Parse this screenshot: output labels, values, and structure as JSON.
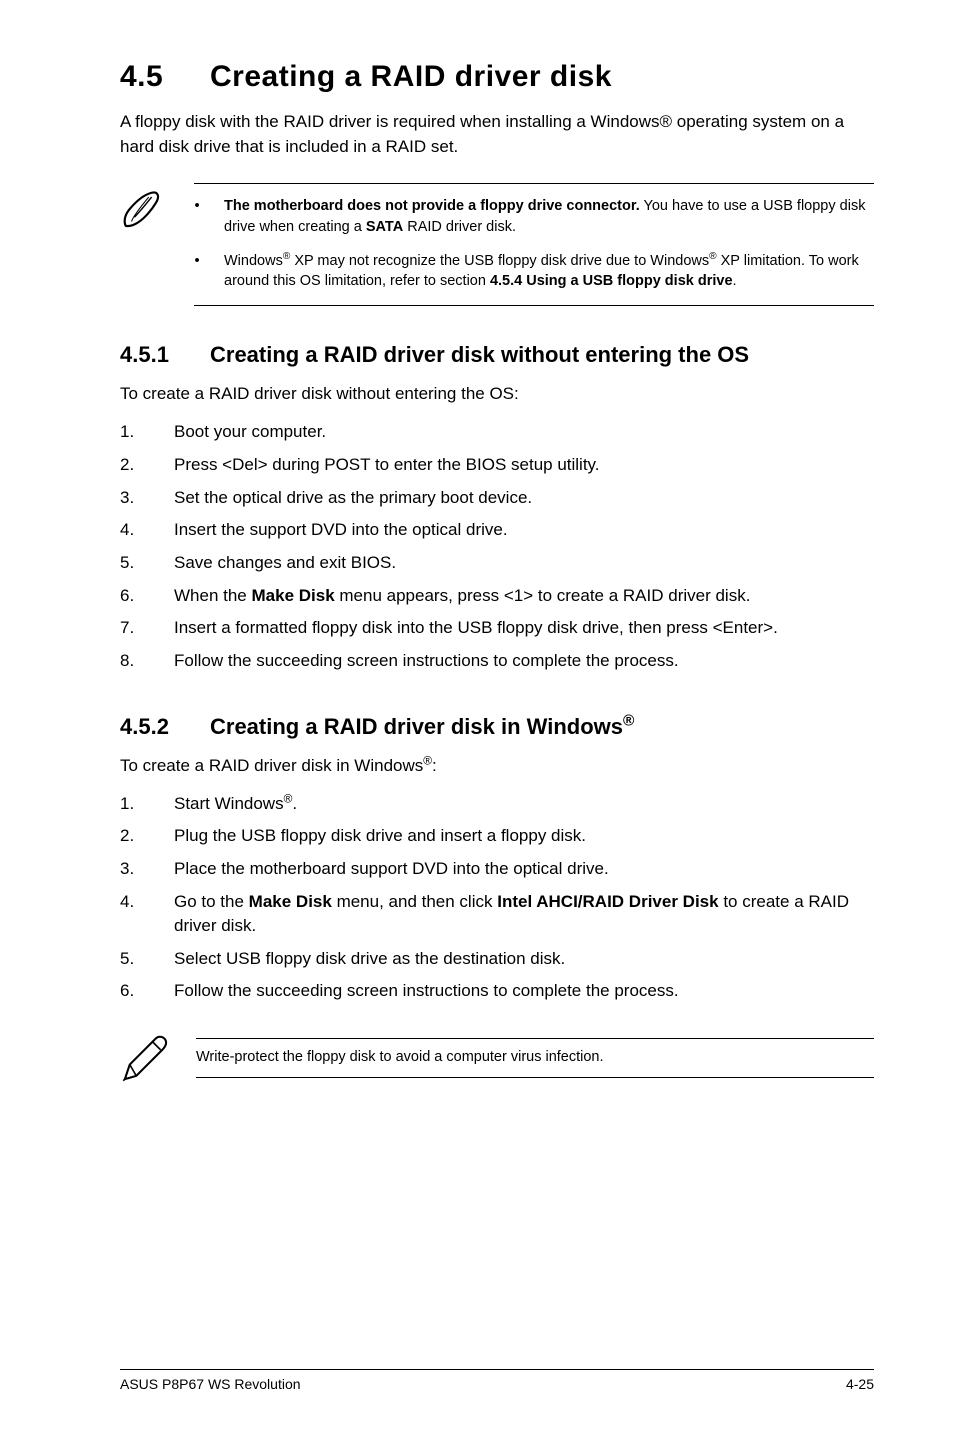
{
  "header": {
    "num": "4.5",
    "title": "Creating a RAID driver disk"
  },
  "intro": "A floppy disk with the RAID driver is required when installing a Windows® operating system on a hard disk drive that is included in a RAID set.",
  "note": {
    "items": [
      {
        "html": "<b>The motherboard does not provide a floppy drive connector.</b> You have to use a USB floppy disk drive when creating a <b>SATA</b> RAID driver disk."
      },
      {
        "html": "Windows<sup>®</sup> XP may not recognize the USB floppy disk drive due to Windows<sup>®</sup> XP limitation. To work around this OS limitation, refer to section <b>4.5.4 Using a USB floppy disk drive</b>."
      }
    ]
  },
  "sec1": {
    "num": "4.5.1",
    "title": "Creating a RAID driver disk without entering the OS",
    "lead": "To create a RAID driver disk without entering the OS:",
    "steps": [
      "Boot your computer.",
      "Press <Del> during POST to enter the BIOS setup utility.",
      "Set the optical drive as the primary boot device.",
      "Insert the support DVD into the optical drive.",
      "Save changes and exit BIOS.",
      "When the <b>Make Disk</b> menu appears, press <1> to create a RAID driver disk.",
      "Insert a formatted floppy disk into the USB floppy disk drive, then press <Enter>.",
      "Follow the succeeding screen instructions to complete the process."
    ]
  },
  "sec2": {
    "num": "4.5.2",
    "title_html": "Creating a RAID driver disk in Windows<sup>®</sup>",
    "lead_html": "To create a RAID driver disk in Windows<sup>®</sup>:",
    "steps": [
      "Start Windows<sup>®</sup>.",
      "Plug the USB floppy disk drive and insert a floppy disk.",
      "Place the motherboard support DVD into the optical drive.",
      "Go to the <b>Make Disk</b> menu, and then click <b>Intel AHCI/RAID Driver Disk</b> to create a RAID driver disk.",
      "Select USB floppy disk drive as the destination disk.",
      "Follow the succeeding screen instructions to complete the process."
    ]
  },
  "tip": "Write-protect the floppy disk to avoid a computer virus infection.",
  "footer": {
    "left": "ASUS P8P67 WS Revolution",
    "right": "4-25"
  }
}
